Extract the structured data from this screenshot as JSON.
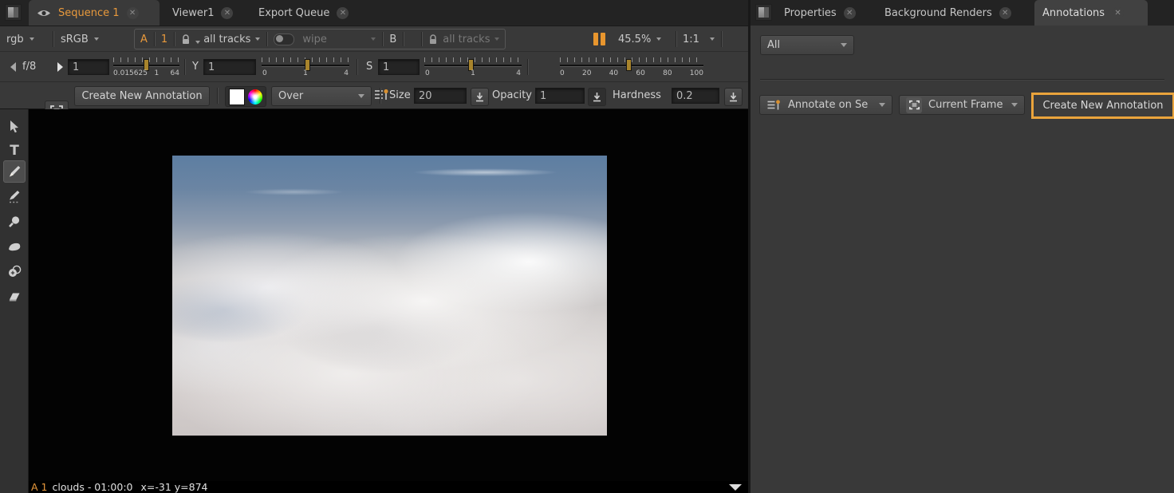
{
  "left_tabs": {
    "sequence": "Sequence 1",
    "viewer": "Viewer1",
    "export_queue": "Export Queue"
  },
  "viewer_toolbar": {
    "channels": "rgb",
    "colorspace": "sRGB",
    "input_a": "A",
    "version_a": "1",
    "tracks_a": "all tracks",
    "wipe_mode": "wipe",
    "input_b": "B",
    "tracks_b": "all tracks",
    "zoom_level": "45.5%",
    "proxy_ratio": "1:1"
  },
  "exposure_toolbar": {
    "fstop": "f/8",
    "gain": {
      "value": "1",
      "tick_labels": [
        "0.015625",
        "1",
        "64"
      ]
    },
    "gamma": {
      "label": "Y",
      "value": "1",
      "tick_labels": [
        "0",
        "1",
        "4"
      ]
    },
    "saturation": {
      "label": "S",
      "value": "1",
      "tick_labels": [
        "0",
        "1",
        "4"
      ]
    },
    "volume": {
      "tick_labels": [
        "0",
        "20",
        "40",
        "60",
        "80",
        "100"
      ]
    }
  },
  "annotation_toolbar": {
    "create_button": "Create New Annotation",
    "blend_mode": "Over",
    "size_label": "Size",
    "size_value": "20",
    "opacity_label": "Opacity",
    "opacity_value": "1",
    "hardness_label": "Hardness",
    "hardness_value": "0.2"
  },
  "status_bar": {
    "input_track": "A 1",
    "clip_info": "clouds - 01:00:0",
    "cursor_coords": "x=-31 y=874"
  },
  "right_tabs": {
    "properties": "Properties",
    "background_renders": "Background Renders",
    "annotations": "Annotations"
  },
  "annotations_panel": {
    "filter_value": "All",
    "annotate_on_value": "Annotate on Se",
    "frame_range_value": "Current Frame",
    "create_button": "Create New Annotation"
  },
  "icons": {
    "close_glyph": "✕",
    "text_tool_glyph": "T"
  },
  "colors": {
    "accent_orange": "#e8993c",
    "highlight_border": "#eaa43c",
    "slider_handle": "#a8842c"
  }
}
